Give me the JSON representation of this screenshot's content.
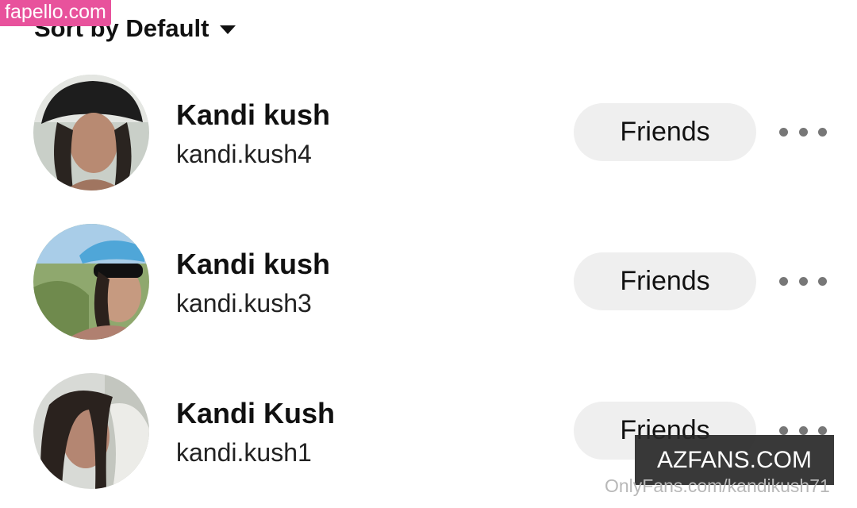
{
  "watermark_top": "fapello.com",
  "sort": {
    "label": "Sort by Default"
  },
  "contacts": [
    {
      "name": "Kandi kush",
      "handle": "kandi.kush4",
      "action": "Friends"
    },
    {
      "name": "Kandi kush",
      "handle": "kandi.kush3",
      "action": "Friends"
    },
    {
      "name": "Kandi Kush",
      "handle": "kandi.kush1",
      "action": "Friends"
    }
  ],
  "watermark_box": "AZFANS.COM",
  "watermark_bottom": "OnlyFans.com/kandikush71",
  "colors": {
    "button_bg": "#efefef",
    "watermark_pink": "#e8529c",
    "dots": "#777777"
  },
  "icons": {
    "sort_caret": "caret-down-icon",
    "more": "more-horizontal-icon"
  }
}
